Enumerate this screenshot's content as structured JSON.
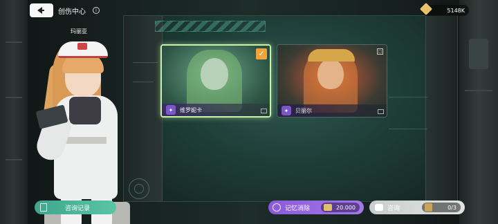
{
  "header": {
    "title": "创伤中心",
    "info_icon": "info-icon",
    "back_icon": "back-arrow-icon"
  },
  "currency": {
    "icon": "gem-icon",
    "value": "5148K"
  },
  "character": {
    "name": "玛丽亚"
  },
  "patients": [
    {
      "name": "维罗妮卡",
      "selected": true,
      "icon": "brain-icon"
    },
    {
      "name": "贝丽尔",
      "selected": false,
      "icon": "brain-icon"
    }
  ],
  "bottom": {
    "consult_log_label": "咨询记录",
    "erase_label": "记忆消除",
    "erase_cost": "20.000",
    "ask_label": "咨询",
    "ask_count": "0/3"
  },
  "colors": {
    "accent_green": "#5bc4a4",
    "accent_purple": "#8a5ad8",
    "selected_border": "#c9f3a8",
    "check_orange": "#f0a43a"
  }
}
